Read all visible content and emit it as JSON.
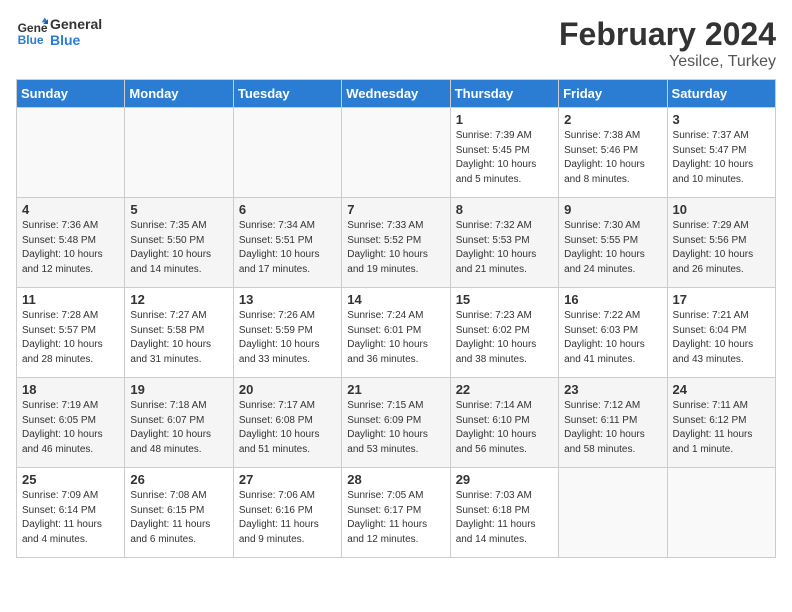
{
  "header": {
    "logo_text1": "General",
    "logo_text2": "Blue",
    "month": "February 2024",
    "location": "Yesilce, Turkey"
  },
  "weekdays": [
    "Sunday",
    "Monday",
    "Tuesday",
    "Wednesday",
    "Thursday",
    "Friday",
    "Saturday"
  ],
  "weeks": [
    [
      {
        "day": "",
        "info": ""
      },
      {
        "day": "",
        "info": ""
      },
      {
        "day": "",
        "info": ""
      },
      {
        "day": "",
        "info": ""
      },
      {
        "day": "1",
        "info": "Sunrise: 7:39 AM\nSunset: 5:45 PM\nDaylight: 10 hours\nand 5 minutes."
      },
      {
        "day": "2",
        "info": "Sunrise: 7:38 AM\nSunset: 5:46 PM\nDaylight: 10 hours\nand 8 minutes."
      },
      {
        "day": "3",
        "info": "Sunrise: 7:37 AM\nSunset: 5:47 PM\nDaylight: 10 hours\nand 10 minutes."
      }
    ],
    [
      {
        "day": "4",
        "info": "Sunrise: 7:36 AM\nSunset: 5:48 PM\nDaylight: 10 hours\nand 12 minutes."
      },
      {
        "day": "5",
        "info": "Sunrise: 7:35 AM\nSunset: 5:50 PM\nDaylight: 10 hours\nand 14 minutes."
      },
      {
        "day": "6",
        "info": "Sunrise: 7:34 AM\nSunset: 5:51 PM\nDaylight: 10 hours\nand 17 minutes."
      },
      {
        "day": "7",
        "info": "Sunrise: 7:33 AM\nSunset: 5:52 PM\nDaylight: 10 hours\nand 19 minutes."
      },
      {
        "day": "8",
        "info": "Sunrise: 7:32 AM\nSunset: 5:53 PM\nDaylight: 10 hours\nand 21 minutes."
      },
      {
        "day": "9",
        "info": "Sunrise: 7:30 AM\nSunset: 5:55 PM\nDaylight: 10 hours\nand 24 minutes."
      },
      {
        "day": "10",
        "info": "Sunrise: 7:29 AM\nSunset: 5:56 PM\nDaylight: 10 hours\nand 26 minutes."
      }
    ],
    [
      {
        "day": "11",
        "info": "Sunrise: 7:28 AM\nSunset: 5:57 PM\nDaylight: 10 hours\nand 28 minutes."
      },
      {
        "day": "12",
        "info": "Sunrise: 7:27 AM\nSunset: 5:58 PM\nDaylight: 10 hours\nand 31 minutes."
      },
      {
        "day": "13",
        "info": "Sunrise: 7:26 AM\nSunset: 5:59 PM\nDaylight: 10 hours\nand 33 minutes."
      },
      {
        "day": "14",
        "info": "Sunrise: 7:24 AM\nSunset: 6:01 PM\nDaylight: 10 hours\nand 36 minutes."
      },
      {
        "day": "15",
        "info": "Sunrise: 7:23 AM\nSunset: 6:02 PM\nDaylight: 10 hours\nand 38 minutes."
      },
      {
        "day": "16",
        "info": "Sunrise: 7:22 AM\nSunset: 6:03 PM\nDaylight: 10 hours\nand 41 minutes."
      },
      {
        "day": "17",
        "info": "Sunrise: 7:21 AM\nSunset: 6:04 PM\nDaylight: 10 hours\nand 43 minutes."
      }
    ],
    [
      {
        "day": "18",
        "info": "Sunrise: 7:19 AM\nSunset: 6:05 PM\nDaylight: 10 hours\nand 46 minutes."
      },
      {
        "day": "19",
        "info": "Sunrise: 7:18 AM\nSunset: 6:07 PM\nDaylight: 10 hours\nand 48 minutes."
      },
      {
        "day": "20",
        "info": "Sunrise: 7:17 AM\nSunset: 6:08 PM\nDaylight: 10 hours\nand 51 minutes."
      },
      {
        "day": "21",
        "info": "Sunrise: 7:15 AM\nSunset: 6:09 PM\nDaylight: 10 hours\nand 53 minutes."
      },
      {
        "day": "22",
        "info": "Sunrise: 7:14 AM\nSunset: 6:10 PM\nDaylight: 10 hours\nand 56 minutes."
      },
      {
        "day": "23",
        "info": "Sunrise: 7:12 AM\nSunset: 6:11 PM\nDaylight: 10 hours\nand 58 minutes."
      },
      {
        "day": "24",
        "info": "Sunrise: 7:11 AM\nSunset: 6:12 PM\nDaylight: 11 hours\nand 1 minute."
      }
    ],
    [
      {
        "day": "25",
        "info": "Sunrise: 7:09 AM\nSunset: 6:14 PM\nDaylight: 11 hours\nand 4 minutes."
      },
      {
        "day": "26",
        "info": "Sunrise: 7:08 AM\nSunset: 6:15 PM\nDaylight: 11 hours\nand 6 minutes."
      },
      {
        "day": "27",
        "info": "Sunrise: 7:06 AM\nSunset: 6:16 PM\nDaylight: 11 hours\nand 9 minutes."
      },
      {
        "day": "28",
        "info": "Sunrise: 7:05 AM\nSunset: 6:17 PM\nDaylight: 11 hours\nand 12 minutes."
      },
      {
        "day": "29",
        "info": "Sunrise: 7:03 AM\nSunset: 6:18 PM\nDaylight: 11 hours\nand 14 minutes."
      },
      {
        "day": "",
        "info": ""
      },
      {
        "day": "",
        "info": ""
      }
    ]
  ]
}
